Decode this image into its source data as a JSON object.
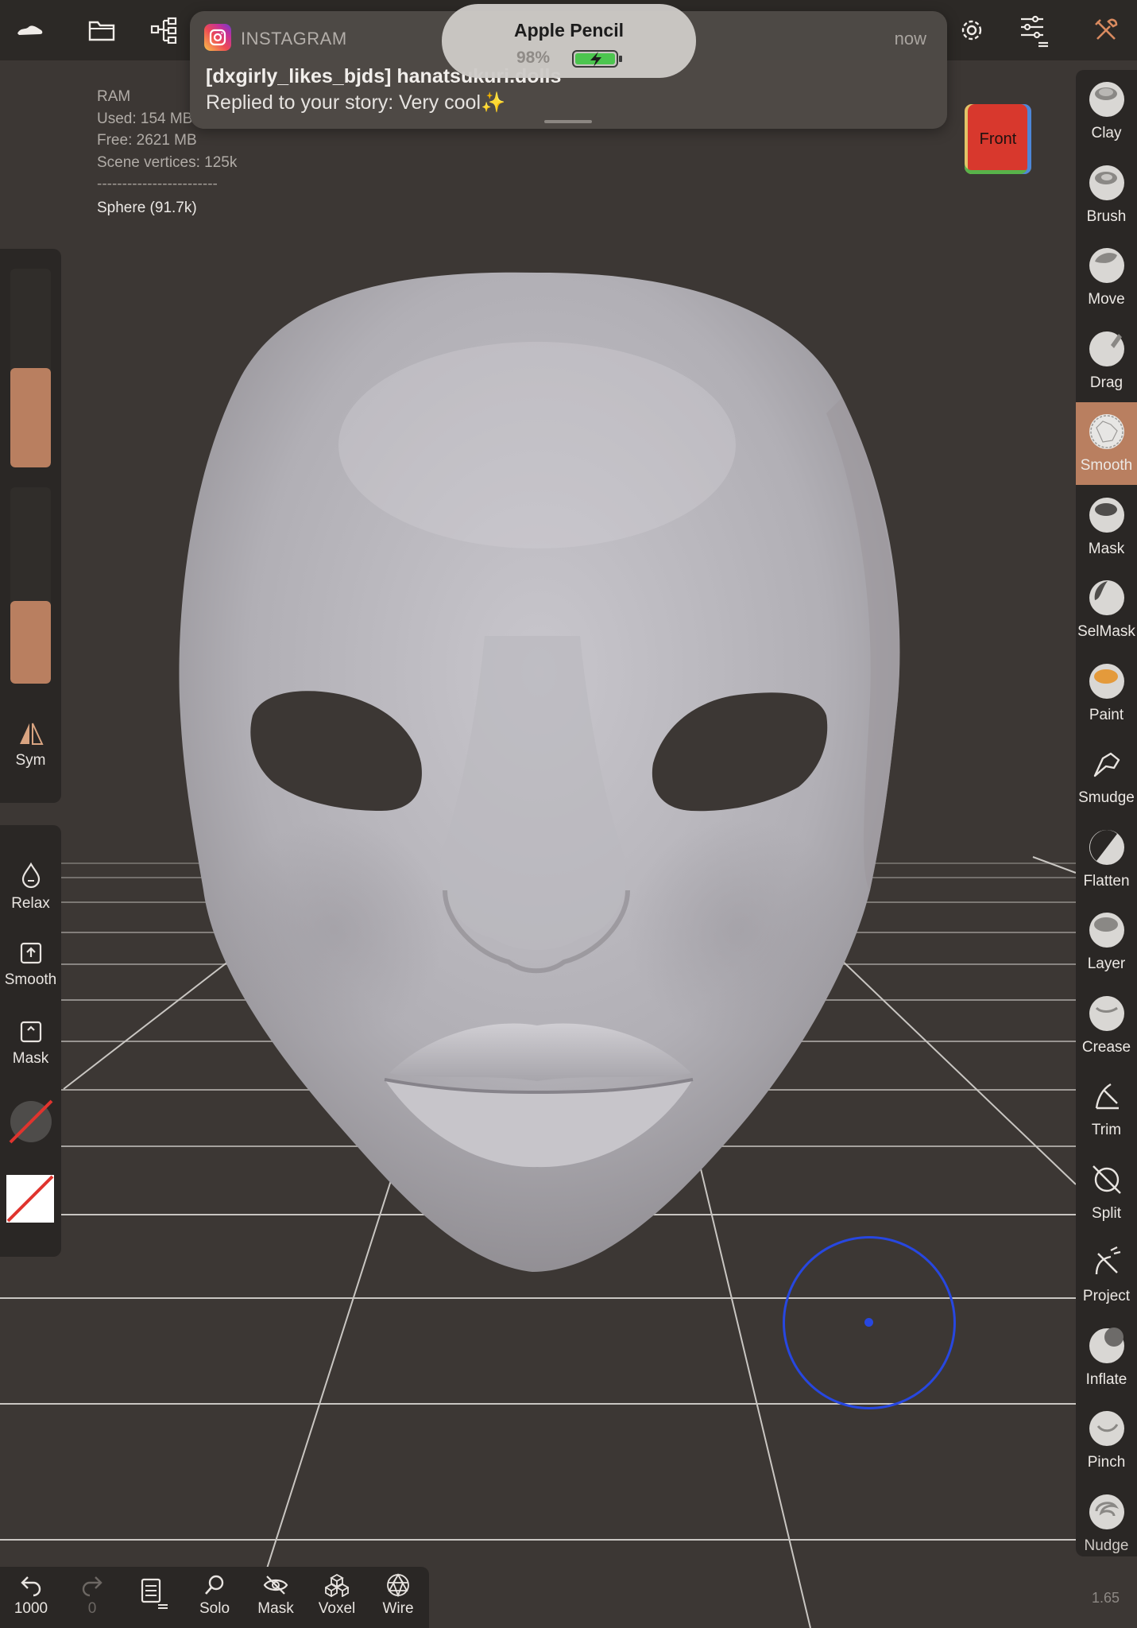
{
  "topbar": {
    "icons": [
      "shoe-logo-icon",
      "folder-icon",
      "scene-tree-icon",
      "settings-gear-icon",
      "sliders-icon",
      "tools-icon"
    ]
  },
  "notification": {
    "app": "INSTAGRAM",
    "time": "now",
    "title": "[dxgirly_likes_bjds] hanatsukuri.dolls",
    "body": "Replied to your story: Very cool✨"
  },
  "pencil": {
    "title": "Apple Pencil",
    "battery": "98%"
  },
  "stats": {
    "ram": "RAM",
    "used": "Used: 154 MB",
    "free": "Free: 2621 MB",
    "vertices": "Scene vertices: 125k",
    "separator": "------------------------",
    "object": "Sphere (91.7k)"
  },
  "view_cube": {
    "label": "Front"
  },
  "left_panel": {
    "radius_level": 0.5,
    "intensity_level": 0.42,
    "sym": "Sym",
    "relax": "Relax",
    "smooth": "Smooth",
    "mask": "Mask"
  },
  "tools": [
    {
      "label": "Clay",
      "icon": "clay-icon"
    },
    {
      "label": "Brush",
      "icon": "brush-icon"
    },
    {
      "label": "Move",
      "icon": "move-icon"
    },
    {
      "label": "Drag",
      "icon": "drag-icon"
    },
    {
      "label": "Smooth",
      "icon": "smooth-icon",
      "active": true
    },
    {
      "label": "Mask",
      "icon": "mask-icon"
    },
    {
      "label": "SelMask",
      "icon": "selmask-icon"
    },
    {
      "label": "Paint",
      "icon": "paint-icon"
    },
    {
      "label": "Smudge",
      "icon": "smudge-icon"
    },
    {
      "label": "Flatten",
      "icon": "flatten-icon"
    },
    {
      "label": "Layer",
      "icon": "layer-icon"
    },
    {
      "label": "Crease",
      "icon": "crease-icon"
    },
    {
      "label": "Trim",
      "icon": "trim-icon"
    },
    {
      "label": "Split",
      "icon": "split-icon"
    },
    {
      "label": "Project",
      "icon": "project-icon"
    },
    {
      "label": "Inflate",
      "icon": "inflate-icon"
    },
    {
      "label": "Pinch",
      "icon": "pinch-icon"
    },
    {
      "label": "Nudge",
      "icon": "nudge-icon"
    }
  ],
  "bottombar": {
    "undo": "1000",
    "redo": "0",
    "solo": "Solo",
    "mask": "Mask",
    "voxel": "Voxel",
    "wire": "Wire"
  },
  "zoom": "1.65",
  "colors": {
    "accent": "#b97f60",
    "background": "#3c3734",
    "panel": "#2a2725",
    "model": "#b2b0b6",
    "cursor": "#2747e0"
  }
}
